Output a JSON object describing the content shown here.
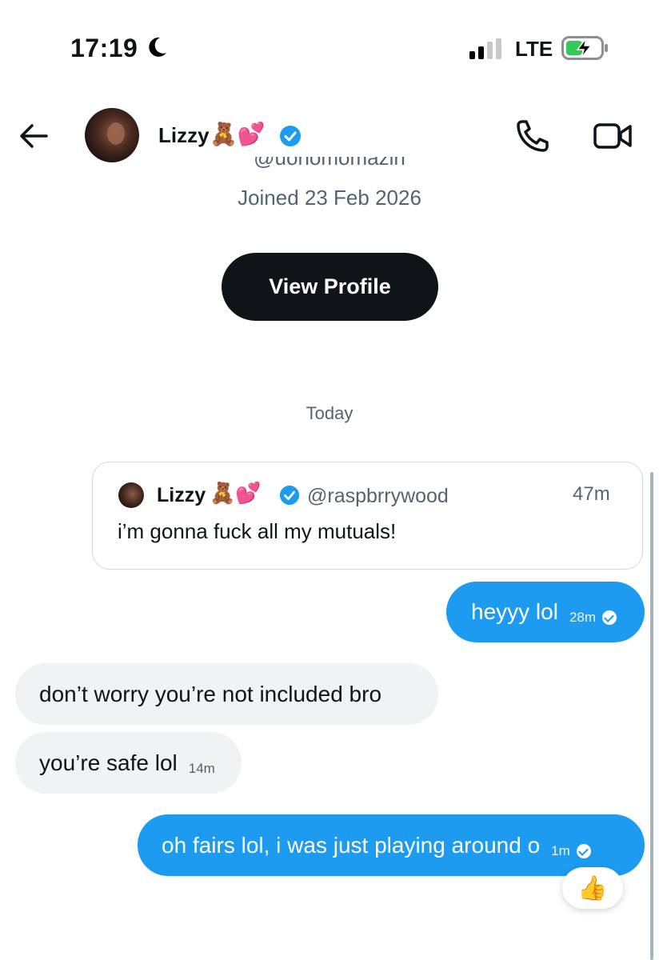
{
  "status_bar": {
    "time": "17:19",
    "network": "LTE",
    "icons": [
      "moon-icon",
      "signal-icon",
      "battery-charging-icon"
    ]
  },
  "header": {
    "name": "Lizzy",
    "emoji": "🧸💕",
    "verified": true,
    "icons": [
      "back-arrow-icon",
      "phone-icon",
      "video-call-icon"
    ]
  },
  "profile": {
    "handle_partial": "@uonomomazin",
    "joined": "Joined 23 Feb 2026",
    "view_profile_label": "View Profile"
  },
  "divider": {
    "date": "Today"
  },
  "quoted_tweet": {
    "name": "Lizzy",
    "emoji": "🧸💕",
    "handle": "@raspbrrywood",
    "time": "47m",
    "text": "i’m gonna fuck all my mutuals!"
  },
  "messages": [
    {
      "direction": "outgoing",
      "text": "heyyy lol",
      "time": "28m",
      "read": true
    },
    {
      "direction": "incoming",
      "text": "don’t worry you’re not included bro",
      "time": ""
    },
    {
      "direction": "incoming",
      "text": "you’re safe lol",
      "time": "14m"
    },
    {
      "direction": "outgoing",
      "text": "oh fairs lol, i was just playing around o",
      "time": "1m",
      "read": true,
      "reaction": "👍"
    }
  ],
  "colors": {
    "accent": "#1d9bf0",
    "incoming_bubble": "#eff3f4",
    "button": "#0f1419",
    "secondary_text": "#536471"
  }
}
